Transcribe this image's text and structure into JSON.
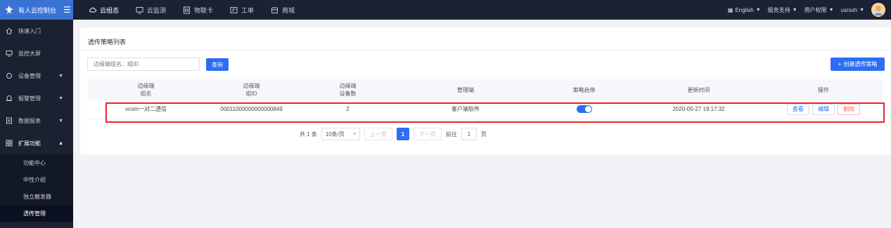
{
  "app": {
    "title": "有人云控制台",
    "menu_icon": "hamburger-icon"
  },
  "topnav": [
    {
      "label": "云组态",
      "icon": "cloud-icon",
      "active": true
    },
    {
      "label": "云监测",
      "icon": "monitor-icon",
      "active": false
    },
    {
      "label": "物联卡",
      "icon": "sim-card-icon",
      "active": false
    },
    {
      "label": "工单",
      "icon": "ticket-icon",
      "active": false
    },
    {
      "label": "商城",
      "icon": "shop-icon",
      "active": false
    }
  ],
  "topright": {
    "language": "English",
    "support": "服务支持",
    "permissions": "用户权限",
    "user": "usrsxh"
  },
  "sidebar": {
    "items": [
      {
        "label": "快速入门",
        "icon": "home-icon",
        "has_arrow": false,
        "arrow": ""
      },
      {
        "label": "监控大屏",
        "icon": "screen-icon",
        "has_arrow": false,
        "arrow": ""
      },
      {
        "label": "设备管理",
        "icon": "device-icon",
        "has_arrow": true,
        "arrow": "▼"
      },
      {
        "label": "报警管理",
        "icon": "alarm-icon",
        "has_arrow": true,
        "arrow": "▼"
      },
      {
        "label": "数据报表",
        "icon": "report-icon",
        "has_arrow": true,
        "arrow": "▼"
      },
      {
        "label": "扩展功能",
        "icon": "extend-icon",
        "has_arrow": true,
        "arrow": "▲"
      }
    ],
    "subitems": [
      {
        "label": "功能中心",
        "active": false
      },
      {
        "label": "中性介绍",
        "active": false
      },
      {
        "label": "独立触发器",
        "active": false
      },
      {
        "label": "透传管理",
        "active": true
      }
    ]
  },
  "page": {
    "title": "透传策略列表",
    "search_placeholder": "边缘端组名、组ID",
    "query_label": "查询",
    "create_label": "创建透传策略",
    "create_icon": "plus-icon"
  },
  "table": {
    "headers": [
      [
        "边缘端",
        "组名"
      ],
      [
        "边缘端",
        "组ID"
      ],
      [
        "边缘端",
        "设备数"
      ],
      [
        "管理端",
        ""
      ],
      [
        "策略启停",
        ""
      ],
      [
        "更新时间",
        ""
      ],
      [
        "操作",
        ""
      ]
    ],
    "rows": [
      {
        "group_name": "vcom一对二透信",
        "group_id": "00011000000000000849",
        "device_count": "2",
        "manager": "客户端软件",
        "enabled": true,
        "updated": "2020-05-27 19:17:32",
        "actions": {
          "view": "查看",
          "edit": "编辑",
          "delete": "删除"
        }
      }
    ]
  },
  "pager": {
    "total": "共 1 条",
    "page_size": "10条/页",
    "prev": "上一页",
    "current": "1",
    "next": "下一页",
    "goto_prefix": "前往",
    "goto_value": "1",
    "goto_suffix": "页"
  },
  "colors": {
    "accent": "#2d6df6",
    "sidebar_bg": "#1b2130",
    "topbar_bg": "#1a2233",
    "brand_bg": "#3a73d4",
    "highlight": "#e8262a"
  }
}
